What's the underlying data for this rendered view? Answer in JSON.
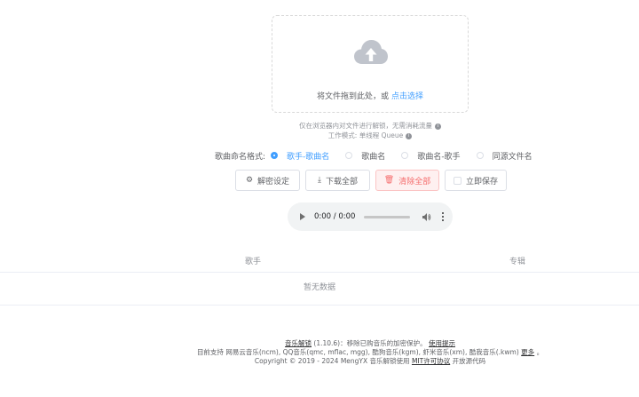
{
  "upload": {
    "prompt": "将文件拖到此处，或",
    "link": "点击选择"
  },
  "tips": {
    "browser_only": "仅在浏览器内对文件进行解锁，无需消耗流量",
    "work_mode": "工作模式: 单线程 Queue"
  },
  "naming": {
    "label": "歌曲命名格式:",
    "options": [
      "歌手-歌曲名",
      "歌曲名",
      "歌曲名-歌手",
      "同源文件名"
    ],
    "selected_index": 0
  },
  "actions": {
    "decrypt_settings": "解密设定",
    "download_all": "下载全部",
    "clear_all": "清除全部",
    "save_now": "立即保存"
  },
  "player": {
    "time": "0:00 / 0:00"
  },
  "table": {
    "columns": [
      "歌手",
      "专辑"
    ],
    "empty": "暂无数据"
  },
  "footer": {
    "app_name": "音乐解锁",
    "version": "(1.10.6)",
    "desc": "：移除已购音乐的加密保护。",
    "usage_link": "使用提示",
    "support": "目前支持 网易云音乐(ncm), QQ音乐(qmc, mflac, mgg), 酷狗音乐(kgm), 虾米音乐(xm), 酷我音乐(.kwm)",
    "more_link": "更多",
    "period": "。",
    "copyright": "Copyright © 2019 - 2024 MengYX 音乐解锁使用",
    "license_link": "MIT许可协议",
    "open_source": "开放源代码"
  },
  "colors": {
    "primary": "#409eff",
    "danger": "#f56c6c"
  }
}
